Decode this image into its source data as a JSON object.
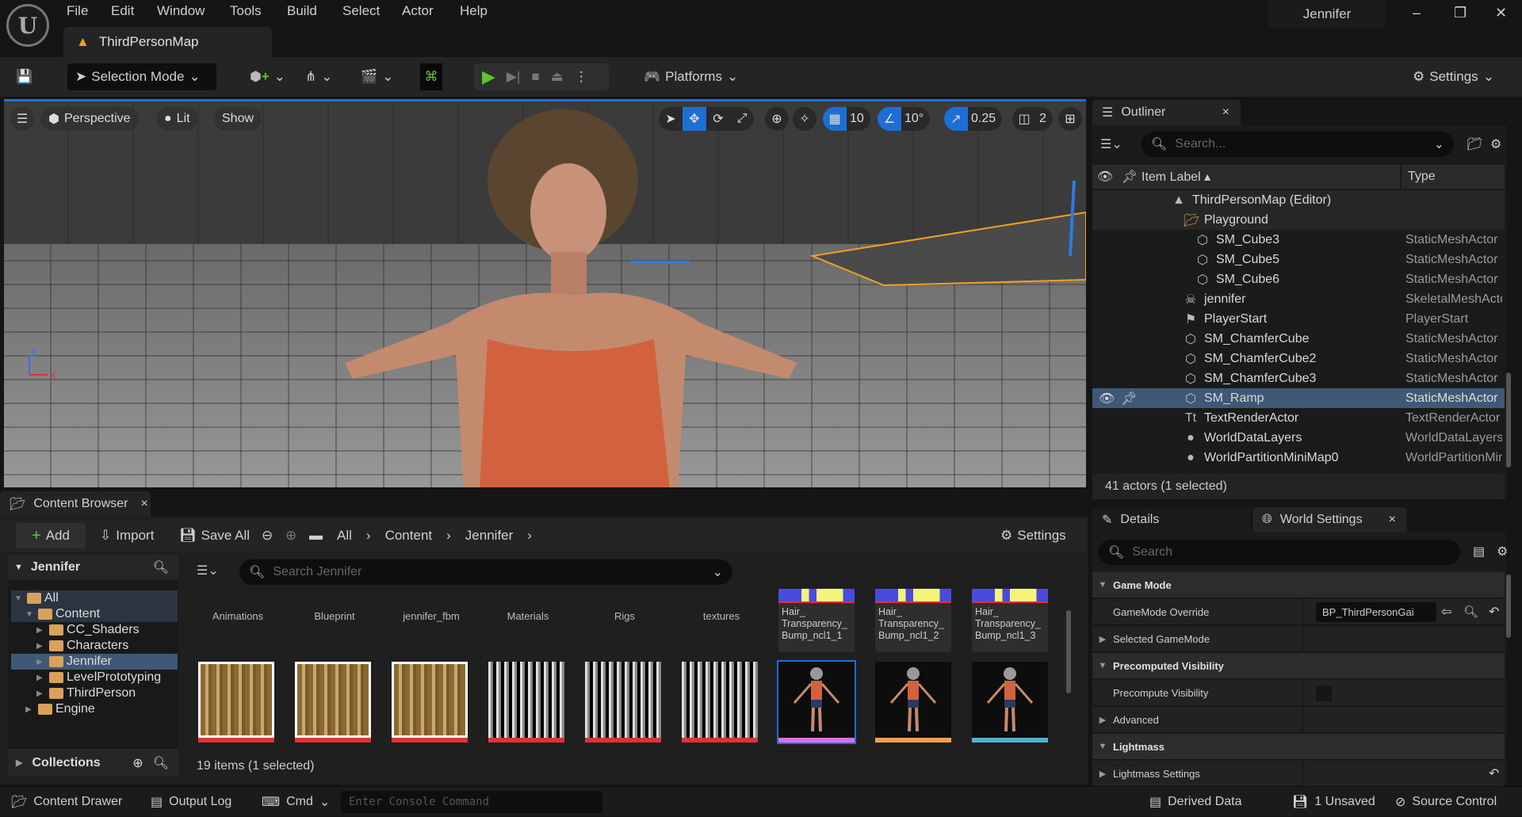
{
  "menu": [
    "File",
    "Edit",
    "Window",
    "Tools",
    "Build",
    "Select",
    "Actor",
    "Help"
  ],
  "document_tab": "ThirdPersonMap",
  "user": "Jennifer",
  "toolbar": {
    "selection_mode": "Selection Mode",
    "platforms": "Platforms",
    "settings": "Settings"
  },
  "viewport": {
    "perspective": "Perspective",
    "lit": "Lit",
    "show": "Show",
    "grid_snap": "10",
    "rotation_snap": "10°",
    "scale_snap": "0.25",
    "camera_speed": "2"
  },
  "outliner": {
    "title": "Outliner",
    "search_placeholder": "Search...",
    "col_label": "Item Label",
    "col_type": "Type",
    "rows": [
      {
        "label": "ThirdPersonMap (Editor)",
        "type": "",
        "icon": "map-icon",
        "indent": 0,
        "group": true
      },
      {
        "label": "Playground",
        "type": "",
        "icon": "folder-icon",
        "indent": 1,
        "group": true
      },
      {
        "label": "SM_Cube3",
        "type": "StaticMeshActor",
        "icon": "static-mesh-icon",
        "indent": 2
      },
      {
        "label": "SM_Cube5",
        "type": "StaticMeshActor",
        "icon": "static-mesh-icon",
        "indent": 2
      },
      {
        "label": "SM_Cube6",
        "type": "StaticMeshActor",
        "icon": "static-mesh-icon",
        "indent": 2
      },
      {
        "label": "jennifer",
        "type": "SkeletalMeshActor",
        "icon": "skeletal-mesh-icon",
        "indent": 1
      },
      {
        "label": "PlayerStart",
        "type": "PlayerStart",
        "icon": "player-start-icon",
        "indent": 1
      },
      {
        "label": "SM_ChamferCube",
        "type": "StaticMeshActor",
        "icon": "static-mesh-icon",
        "indent": 1
      },
      {
        "label": "SM_ChamferCube2",
        "type": "StaticMeshActor",
        "icon": "static-mesh-icon",
        "indent": 1
      },
      {
        "label": "SM_ChamferCube3",
        "type": "StaticMeshActor",
        "icon": "static-mesh-icon",
        "indent": 1
      },
      {
        "label": "SM_Ramp",
        "type": "StaticMeshActor",
        "icon": "static-mesh-icon",
        "indent": 1,
        "selected": true
      },
      {
        "label": "TextRenderActor",
        "type": "TextRenderActor",
        "icon": "text-render-icon",
        "indent": 1
      },
      {
        "label": "WorldDataLayers",
        "type": "WorldDataLayers",
        "icon": "world-data-icon",
        "indent": 1
      },
      {
        "label": "WorldPartitionMiniMap0",
        "type": "WorldPartitionMiniMap",
        "icon": "world-data-icon",
        "indent": 1
      }
    ],
    "status": "41 actors (1 selected)"
  },
  "details": {
    "tab_details": "Details",
    "tab_world_settings": "World Settings",
    "search_placeholder": "Search",
    "rows": [
      {
        "label": "Game Mode",
        "category": true,
        "expanded": true
      },
      {
        "label": "GameMode Override",
        "value": "BP_ThirdPersonGameMode"
      },
      {
        "label": "Selected GameMode",
        "expandable": true
      },
      {
        "label": "Precomputed Visibility",
        "category": true,
        "expanded": true
      },
      {
        "label": "Precompute Visibility",
        "checkbox": false
      },
      {
        "label": "Advanced",
        "expandable": true
      },
      {
        "label": "Lightmass",
        "category": true,
        "expanded": true
      },
      {
        "label": "Lightmass Settings",
        "expandable": true,
        "reset": true
      }
    ],
    "gamemode_display": "BP_ThirdPersonGai"
  },
  "content_browser": {
    "title": "Content Browser",
    "add": "Add",
    "import": "Import",
    "save_all": "Save All",
    "breadcrumb": [
      "All",
      "Content",
      "Jennifer"
    ],
    "settings": "Settings",
    "tree_title": "Jennifer",
    "search_placeholder": "Search Jennifer",
    "tree": [
      {
        "label": "All",
        "depth": 0,
        "expanded": true
      },
      {
        "label": "Content",
        "depth": 1,
        "expanded": true
      },
      {
        "label": "CC_Shaders",
        "depth": 2
      },
      {
        "label": "Characters",
        "depth": 2
      },
      {
        "label": "Jennifer",
        "depth": 2,
        "selected": true
      },
      {
        "label": "LevelPrototyping",
        "depth": 2
      },
      {
        "label": "ThirdPerson",
        "depth": 2
      },
      {
        "label": "Engine",
        "depth": 1
      }
    ],
    "folders": [
      "Animations",
      "Blueprint",
      "jennifer_fbm",
      "Materials",
      "Rigs",
      "textures"
    ],
    "hair_assets": [
      "Hair_ Transparency_ Bump_ncl1_1",
      "Hair_ Transparency_ Bump_ncl1_2",
      "Hair_ Transparency_ Bump_ncl1_3"
    ],
    "collections": "Collections",
    "status": "19 items (1 selected)"
  },
  "statusbar": {
    "content_drawer": "Content Drawer",
    "output_log": "Output Log",
    "cmd": "Cmd",
    "console_placeholder": "Enter Console Command",
    "derived_data": "Derived Data",
    "unsaved": "1 Unsaved",
    "source_control": "Source Control"
  },
  "colors": {
    "accent": "#1d6fd6",
    "selection": "#3f5875",
    "play": "#5ac531",
    "folder": "#d9a15a"
  }
}
